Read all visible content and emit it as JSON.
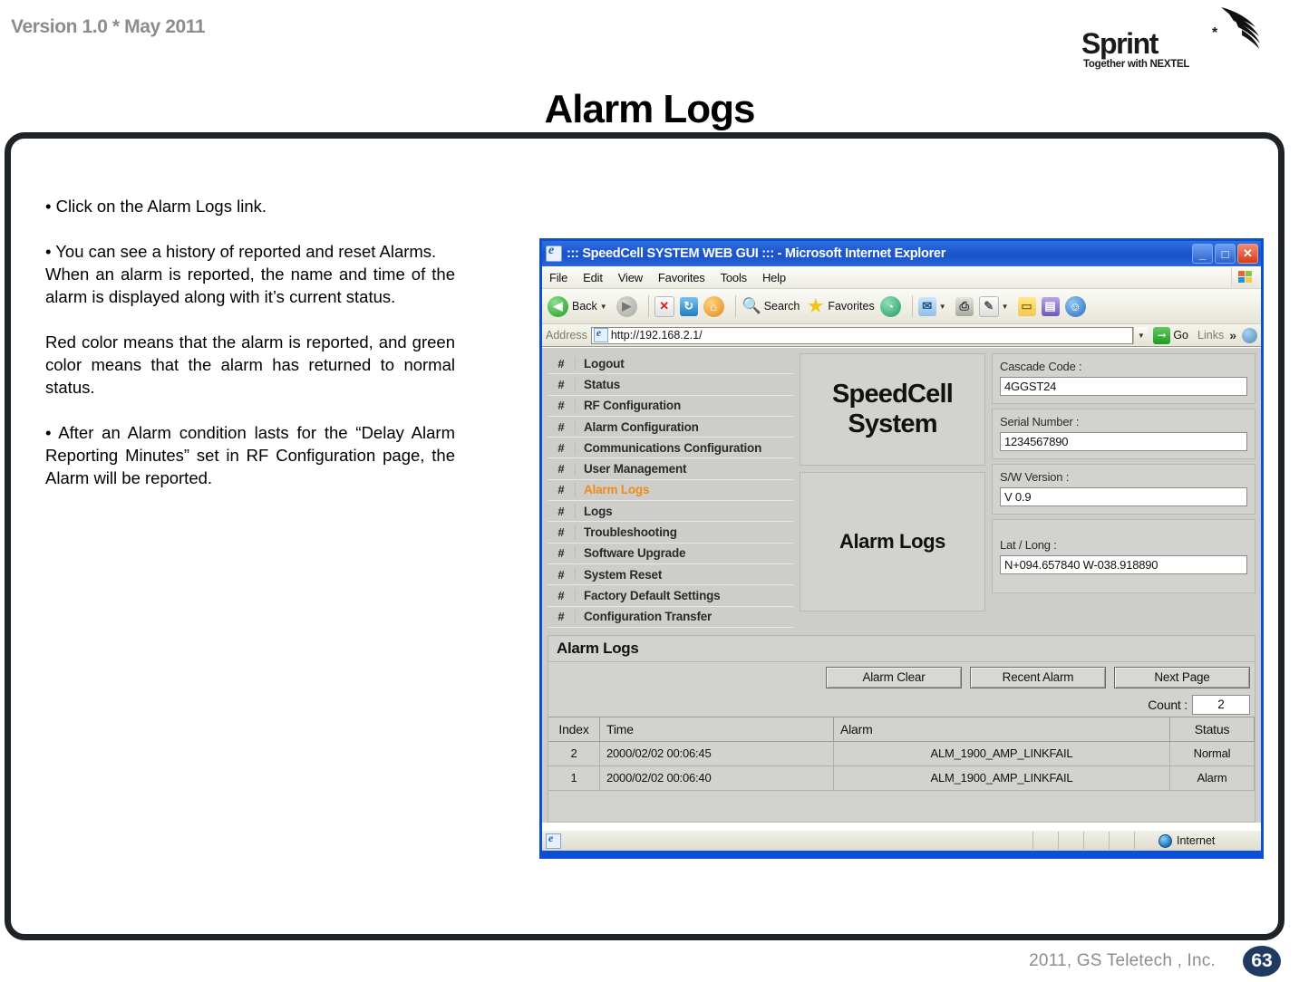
{
  "slide": {
    "version_label": "Version 1.0 * May 2011",
    "title": "Alarm Logs",
    "footer": "2011, GS Teletech , Inc.",
    "page_number": "63",
    "logo": {
      "wordmark": "Sprint",
      "asterisk": "*",
      "tagline": "Together with NEXTEL"
    },
    "bullets": [
      "• Click on the Alarm Logs link.",
      "• You can see a history of reported and reset Alarms.",
      "When an alarm is reported, the name and time of the alarm is displayed along with it’s current status.",
      "Red color means that the alarm is reported, and green color means that the alarm has returned to normal status.",
      "• After an Alarm condition lasts for the “Delay Alarm Reporting Minutes” set in RF Configuration page, the Alarm will be reported."
    ]
  },
  "browser": {
    "title": "::: SpeedCell SYSTEM WEB GUI ::: - Microsoft Internet Explorer",
    "window_buttons": {
      "minimize": "_",
      "maximize": "□",
      "close": "✕"
    },
    "menus": [
      "File",
      "Edit",
      "View",
      "Favorites",
      "Tools",
      "Help"
    ],
    "toolbar": {
      "back": "Back",
      "forward": "",
      "stop": "✕",
      "refresh": "↻",
      "home": "⌂",
      "search": "Search",
      "favorites": "Favorites",
      "history": "◔",
      "mail": "✉",
      "print": "⎙",
      "edit": "✎",
      "notes": "▭",
      "research": "▤",
      "messenger": "☺"
    },
    "address": {
      "label": "Address",
      "url": "http://192.168.2.1/",
      "placeholder": "http://",
      "go_label": "Go",
      "links_label": "Links",
      "chevron": "»"
    },
    "statusbar": {
      "text": "Internet"
    }
  },
  "webapp": {
    "nav": {
      "hash": "#",
      "items": [
        {
          "label": "Logout",
          "active": false
        },
        {
          "label": "Status",
          "active": false
        },
        {
          "label": "RF Configuration",
          "active": false
        },
        {
          "label": "Alarm Configuration",
          "active": false
        },
        {
          "label": "Communications Configuration",
          "active": false
        },
        {
          "label": "User Management",
          "active": false
        },
        {
          "label": "Alarm Logs",
          "active": true
        },
        {
          "label": "Logs",
          "active": false
        },
        {
          "label": "Troubleshooting",
          "active": false
        },
        {
          "label": "Software Upgrade",
          "active": false
        },
        {
          "label": "System Reset",
          "active": false
        },
        {
          "label": "Factory Default Settings",
          "active": false
        },
        {
          "label": "Configuration Transfer",
          "active": false
        }
      ]
    },
    "brand": {
      "line1": "SpeedCell",
      "line2": "System",
      "section": "Alarm Logs"
    },
    "info": [
      {
        "label": "Cascade Code :",
        "value": "4GGST24"
      },
      {
        "label": "Serial Number :",
        "value": "1234567890"
      },
      {
        "label": "S/W Version :",
        "value": "V 0.9"
      },
      {
        "label": "Lat / Long :",
        "value": "N+094.657840 W-038.918890"
      }
    ],
    "logs": {
      "heading": "Alarm Logs",
      "buttons": [
        "Alarm Clear",
        "Recent Alarm",
        "Next Page"
      ],
      "count_label": "Count :",
      "count_value": "2",
      "columns": [
        "Index",
        "Time",
        "Alarm",
        "Status"
      ],
      "rows": [
        {
          "index": "2",
          "time": "2000/02/02 00:06:45",
          "alarm": "ALM_1900_AMP_LINKFAIL",
          "status": "Normal",
          "state": "normal"
        },
        {
          "index": "1",
          "time": "2000/02/02 00:06:40",
          "alarm": "ALM_1900_AMP_LINKFAIL",
          "status": "Alarm",
          "state": "alarm"
        }
      ]
    }
  },
  "colors": {
    "accent_orange": "#f08a1c",
    "status_normal": "#3aa85c",
    "status_alarm": "#f0506e",
    "titlebar_blue": "#1c57cf",
    "page_badge": "#1f3a63"
  }
}
